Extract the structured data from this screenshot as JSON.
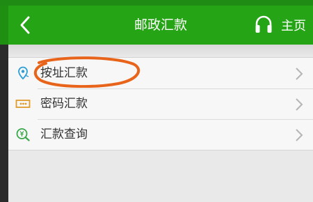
{
  "header": {
    "title": "邮政汇款",
    "home_label": "主页",
    "back_icon": "chevron-left-icon",
    "home_icon": "headset-icon"
  },
  "menu": {
    "items": [
      {
        "label": "按址汇款",
        "icon": "location-pin-icon"
      },
      {
        "label": "密码汇款",
        "icon": "keypad-icon"
      },
      {
        "label": "汇款查询",
        "icon": "yuan-search-icon"
      }
    ]
  },
  "colors": {
    "header_bg": "#25a515",
    "annotation": "#e8641b"
  }
}
